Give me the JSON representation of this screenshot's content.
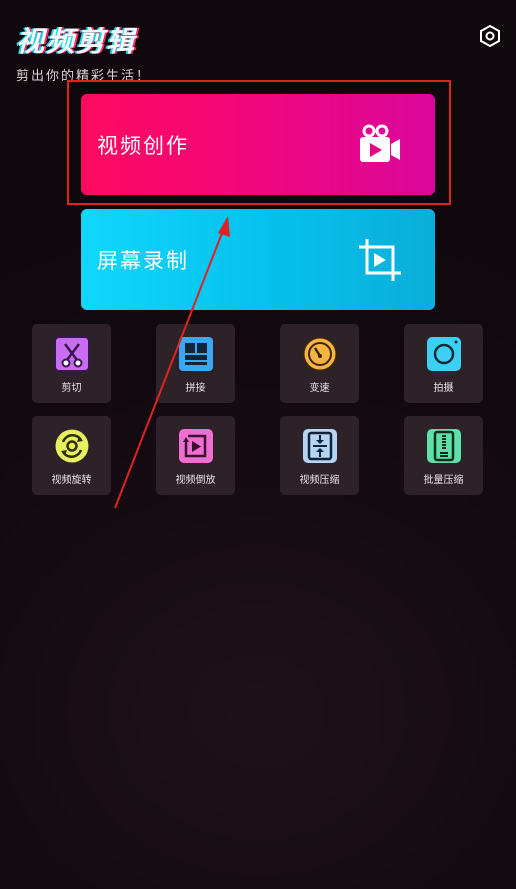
{
  "header": {
    "title": "视频剪辑",
    "subtitle": "剪出你的精彩生活！",
    "settings_icon": "settings-hexagon-icon"
  },
  "cards": [
    {
      "label": "视频创作",
      "icon": "video-camera-icon",
      "color": "#f0077c",
      "highlighted": true
    },
    {
      "label": "屏幕录制",
      "icon": "screen-record-icon",
      "color": "#06c2ee"
    }
  ],
  "tools": [
    {
      "label": "剪切",
      "icon": "scissors-icon",
      "color": "#c86cf0"
    },
    {
      "label": "拼接",
      "icon": "grid-join-icon",
      "color": "#3aa8f5"
    },
    {
      "label": "变速",
      "icon": "speedometer-icon",
      "color": "#f5b540"
    },
    {
      "label": "拍摄",
      "icon": "camera-icon",
      "color": "#3cd0f5"
    },
    {
      "label": "视频旋转",
      "icon": "rotate-icon",
      "color": "#e8f060"
    },
    {
      "label": "视频倒放",
      "icon": "reverse-play-icon",
      "color": "#f06ed0"
    },
    {
      "label": "视频压缩",
      "icon": "compress-icon",
      "color": "#b6d4f5"
    },
    {
      "label": "批量压缩",
      "icon": "zip-icon",
      "color": "#5ee0a8"
    }
  ],
  "annotation": {
    "color": "#e02222"
  }
}
